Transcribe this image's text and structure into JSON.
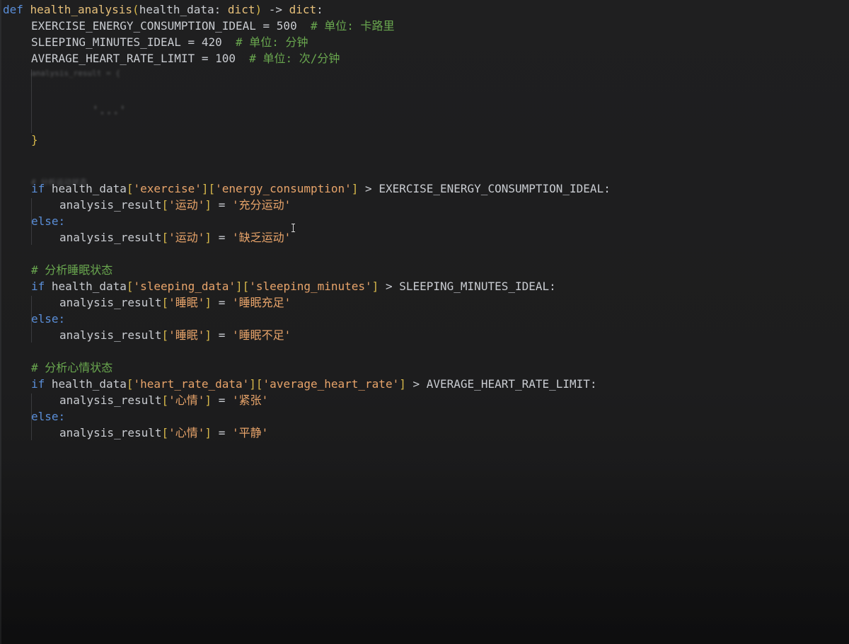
{
  "code": {
    "def_kw": "def",
    "func_name": "health_analysis",
    "param": "health_data",
    "param_type": "dict",
    "arrow": "->",
    "return_type": "dict",
    "const1_name": "EXERCISE_ENERGY_CONSUMPTION_IDEAL",
    "const1_value": "500",
    "const1_comment": "# 单位: 卡路里",
    "const2_name": "SLEEPING_MINUTES_IDEAL",
    "const2_value": "420",
    "const2_comment": "# 单位: 分钟",
    "const3_name": "AVERAGE_HEART_RATE_LIMIT",
    "const3_value": "100",
    "const3_comment": "# 单位: 次/分钟",
    "blurred_dict_line": "analysis_result = {",
    "blurred_inner": "'...'",
    "close_brace": "}",
    "blurred_comment": "# 分析运动状态",
    "if_kw": "if",
    "else_kw": "else:",
    "var_health_data": "health_data",
    "var_result": "analysis_result",
    "exercise_key": "'exercise'",
    "energy_key": "'energy_consumption'",
    "key_sport": "'运动'",
    "val_sport_ok": "'充分运动'",
    "val_sport_bad": "'缺乏运动'",
    "comment_sleep": "# 分析睡眠状态",
    "sleeping_data_key": "'sleeping_data'",
    "sleeping_minutes_key": "'sleeping_minutes'",
    "key_sleep": "'睡眠'",
    "val_sleep_ok": "'睡眠充足'",
    "val_sleep_bad": "'睡眠不足'",
    "comment_mood": "# 分析心情状态",
    "heart_rate_data_key": "'heart_rate_data'",
    "average_heart_rate_key": "'average_heart_rate'",
    "key_mood": "'心情'",
    "val_mood_tense": "'紧张'",
    "val_mood_calm": "'平静'"
  }
}
